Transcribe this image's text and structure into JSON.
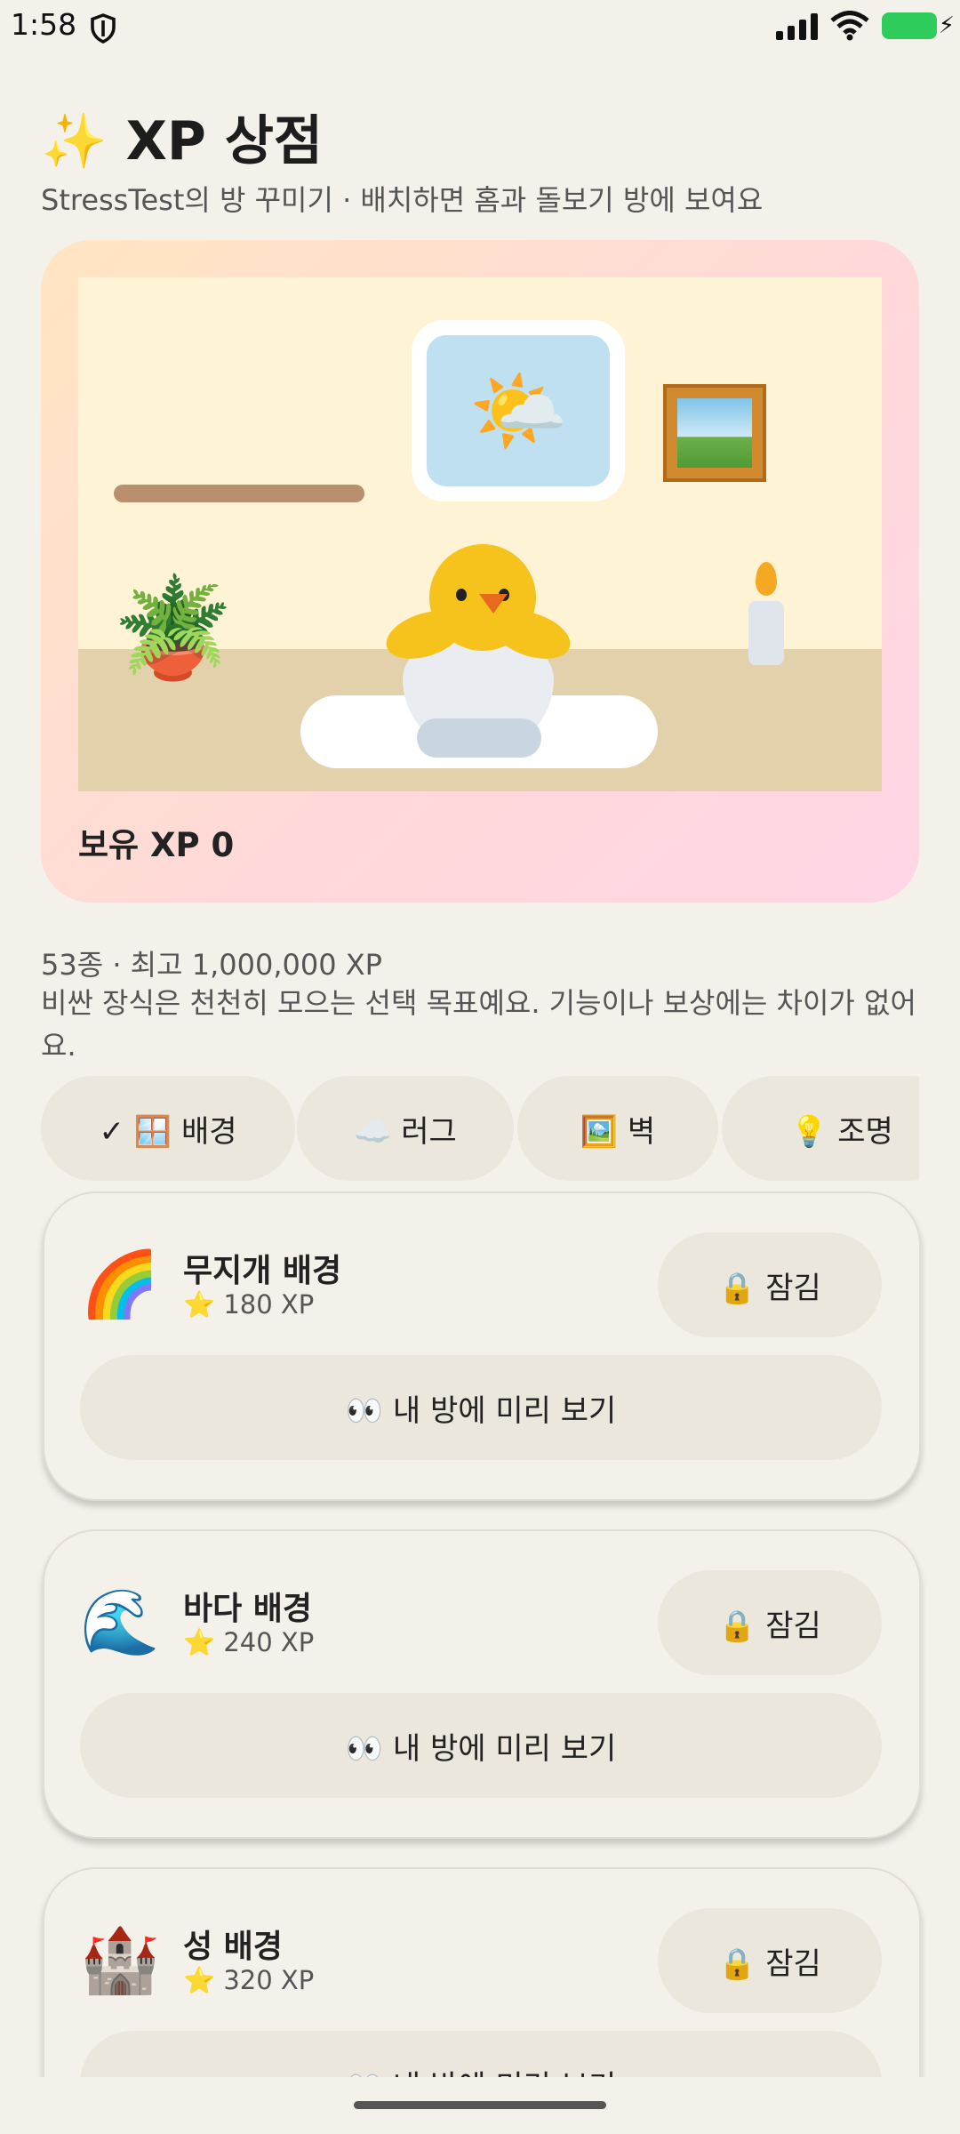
{
  "status_bar": {
    "time": "1:58"
  },
  "header": {
    "title": "✨ XP 상점",
    "subtitle": "StressTest의 방 꾸미기 · 배치하면 홈과 돌보기 방에 보여요"
  },
  "hero": {
    "xp_label": "보유 XP 0"
  },
  "info": {
    "summary": "53종 · 최고 1,000,000 XP",
    "note": "비싼 장식은 천천히 모으는 선택 목표예요. 기능이나 보상에는 차이가 없어요."
  },
  "categories": [
    {
      "label": "✓ 🪟 배경",
      "selected": true
    },
    {
      "label": "☁️ 러그",
      "selected": false
    },
    {
      "label": "🖼️ 벽",
      "selected": false
    },
    {
      "label": "💡 조명",
      "selected": false
    }
  ],
  "items": [
    {
      "icon": "🌈",
      "name": "무지개 배경",
      "price": "⭐ 180 XP",
      "lock_label": "🔒 잠김",
      "preview_label": "👀 내 방에 미리 보기"
    },
    {
      "icon": "🌊",
      "name": "바다 배경",
      "price": "⭐ 240 XP",
      "lock_label": "🔒 잠김",
      "preview_label": "👀 내 방에 미리 보기"
    },
    {
      "icon": "🏰",
      "name": "성 배경",
      "price": "⭐ 320 XP",
      "lock_label": "🔒 잠김",
      "preview_label": "👀 내 방에 미리 보기"
    }
  ],
  "colors": {
    "background": "#f4f1ea",
    "chip": "#ebe7dc",
    "battery": "#2ecc5a"
  }
}
